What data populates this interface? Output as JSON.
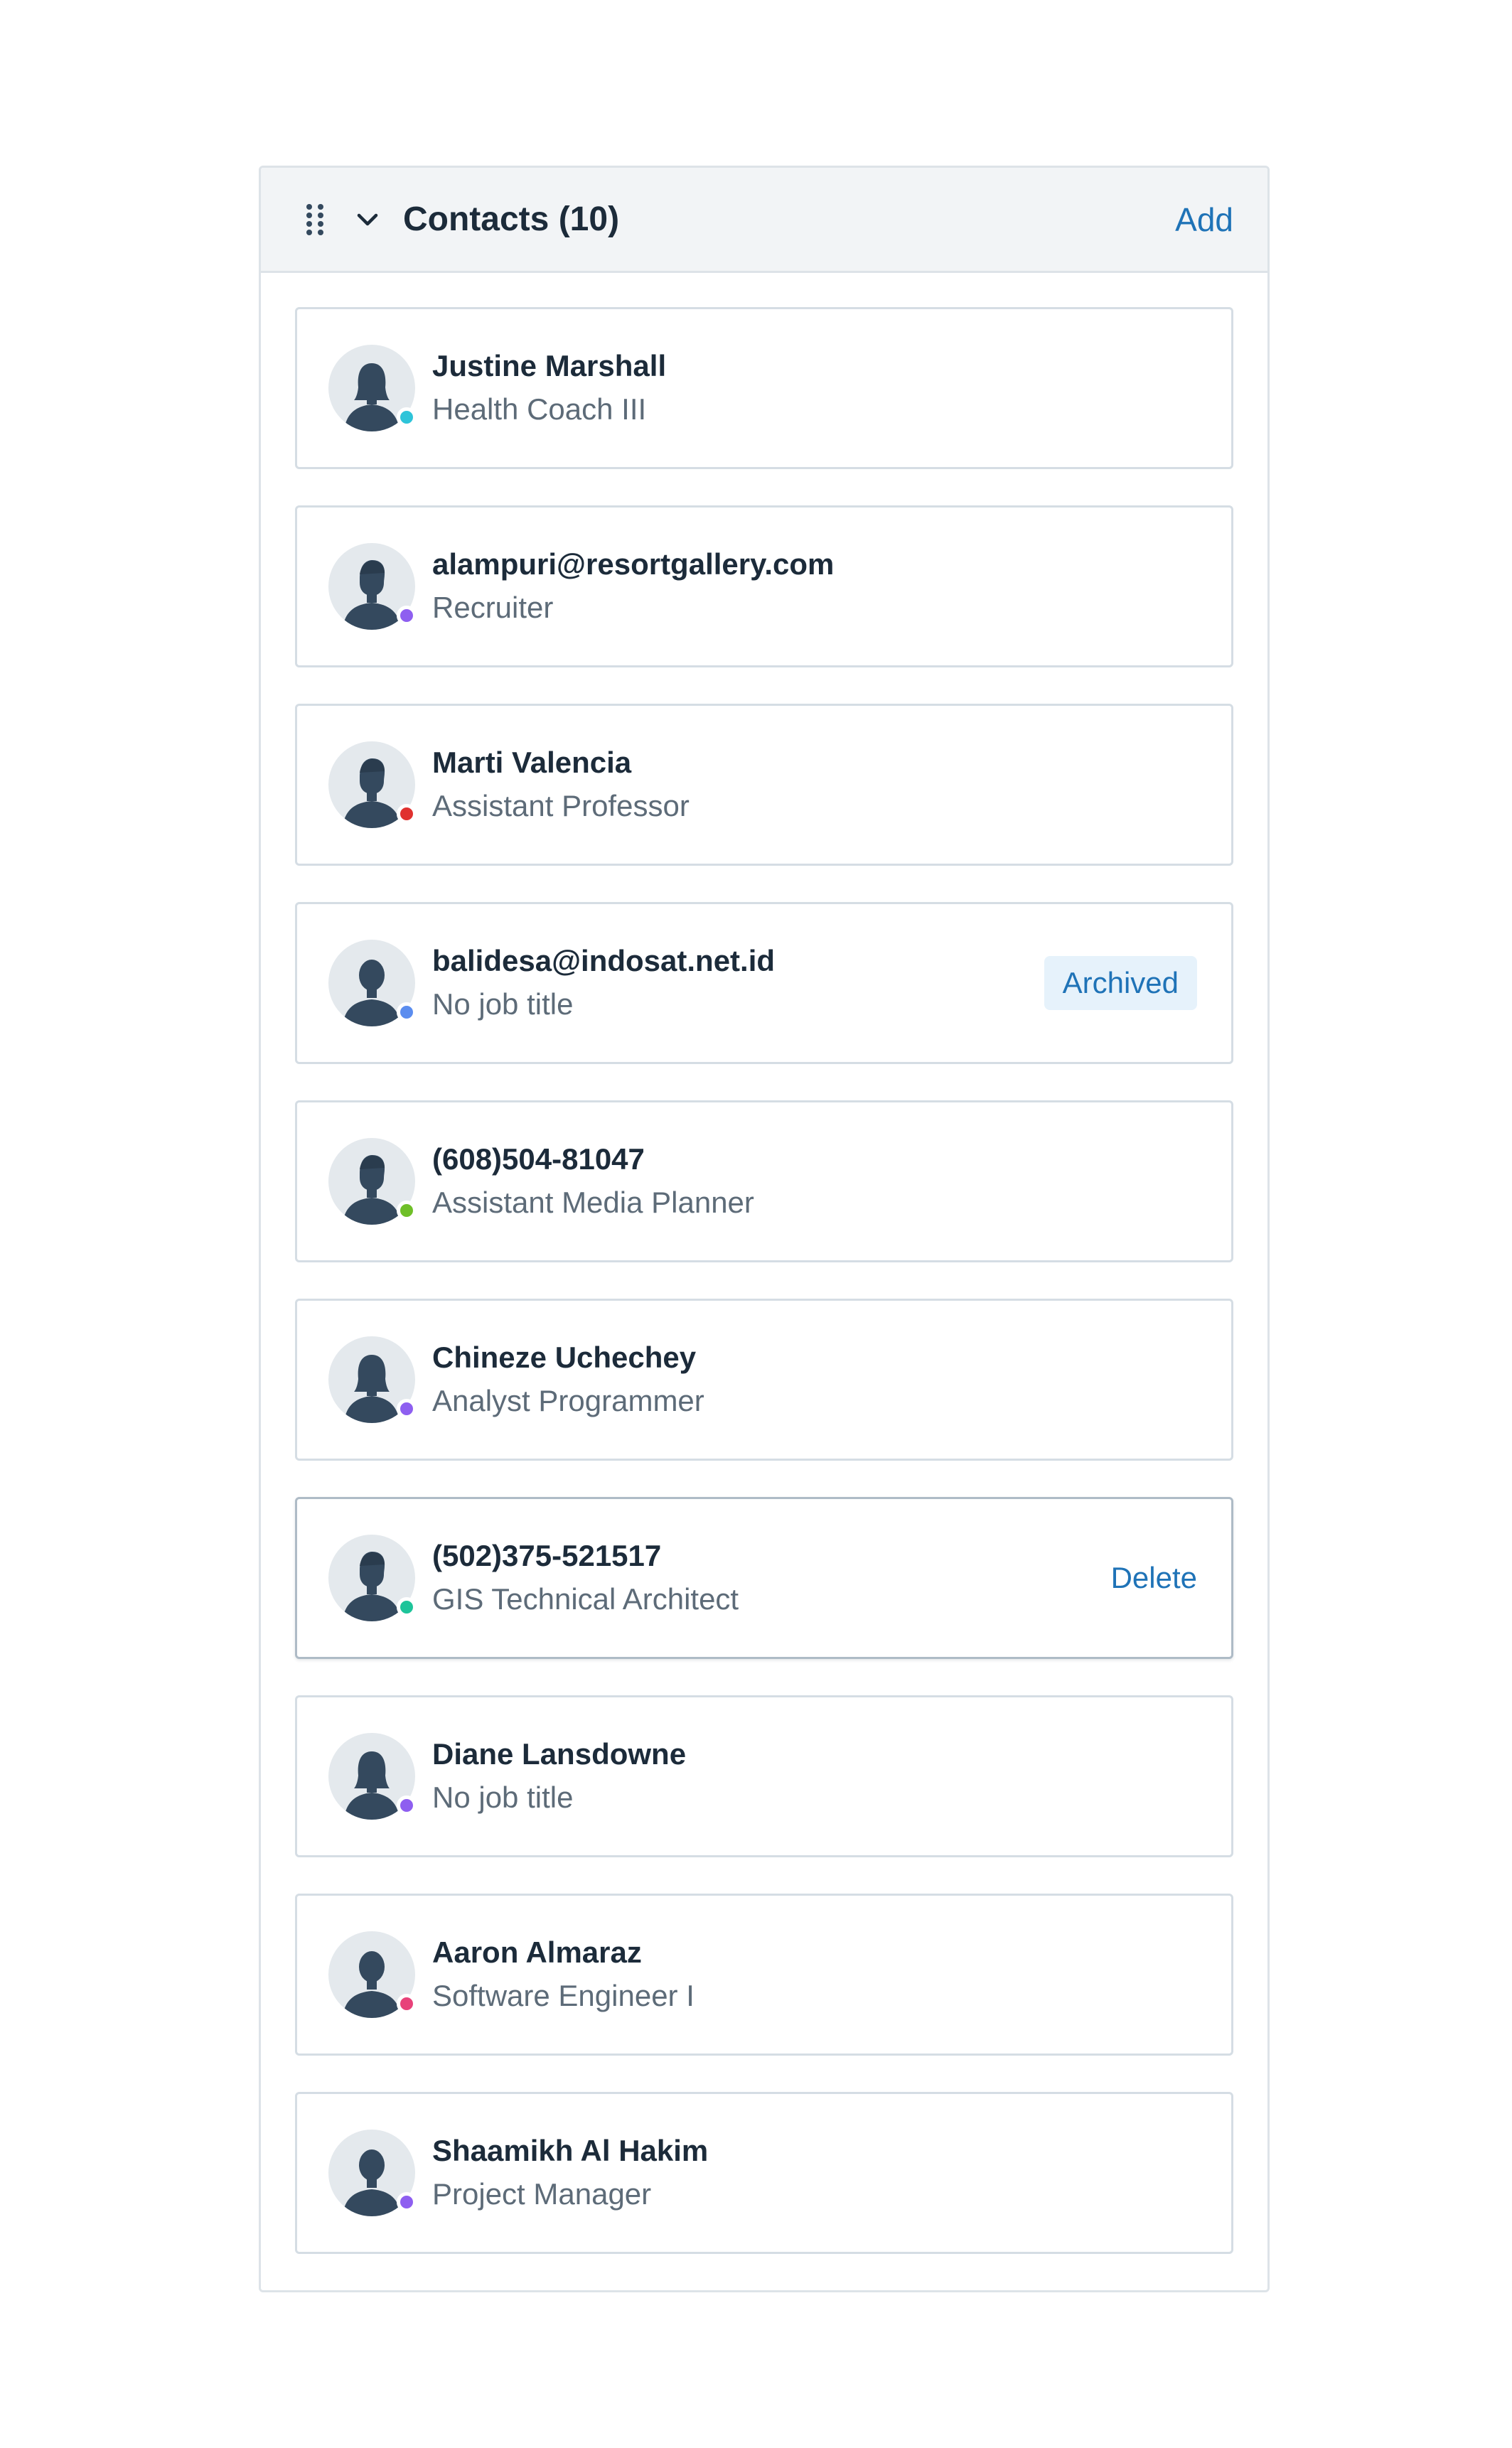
{
  "panel": {
    "title": "Contacts (10)",
    "add_label": "Add"
  },
  "contacts": [
    {
      "name": "Justine Marshall",
      "title": "Health Coach III",
      "avatar": "female-avatar-icon",
      "status_color": "#2ec4d9",
      "badge": "",
      "action": ""
    },
    {
      "name": "alampuri@resortgallery.com",
      "title": "Recruiter",
      "avatar": "male-avatar-icon",
      "status_color": "#8e5ff0",
      "badge": "",
      "action": ""
    },
    {
      "name": "Marti Valencia",
      "title": "Assistant Professor",
      "avatar": "male-avatar-icon",
      "status_color": "#e0312f",
      "badge": "",
      "action": ""
    },
    {
      "name": "balidesa@indosat.net.id",
      "title": "No job title",
      "avatar": "neutral-avatar-icon",
      "status_color": "#5b8def",
      "badge": "Archived",
      "action": ""
    },
    {
      "name": "(608)504-81047",
      "title": "Assistant Media Planner",
      "avatar": "male-avatar-icon",
      "status_color": "#6fbf28",
      "badge": "",
      "action": ""
    },
    {
      "name": "Chineze Uchechey",
      "title": "Analyst Programmer",
      "avatar": "female-avatar-icon",
      "status_color": "#8e5ff0",
      "badge": "",
      "action": ""
    },
    {
      "name": "(502)375-521517",
      "title": "GIS Technical Architect",
      "avatar": "male-avatar-icon",
      "status_color": "#1ec49a",
      "badge": "",
      "action": "Delete"
    },
    {
      "name": "Diane Lansdowne",
      "title": "No job title",
      "avatar": "female-avatar-icon",
      "status_color": "#8e5ff0",
      "badge": "",
      "action": ""
    },
    {
      "name": "Aaron Almaraz",
      "title": "Software Engineer I",
      "avatar": "neutral-avatar-icon",
      "status_color": "#e8427a",
      "badge": "",
      "action": ""
    },
    {
      "name": "Shaamikh Al Hakim",
      "title": "Project Manager",
      "avatar": "neutral-avatar-icon",
      "status_color": "#8e5ff0",
      "badge": "",
      "action": ""
    }
  ]
}
